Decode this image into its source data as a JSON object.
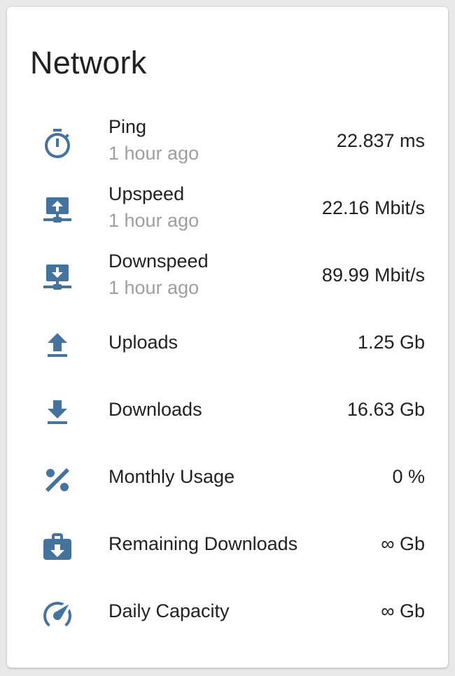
{
  "card": {
    "title": "Network"
  },
  "accent_color": "#44739e",
  "rows": [
    {
      "icon": "timer-icon",
      "name": "Ping",
      "sub": "1 hour ago",
      "value": "22.837 ms"
    },
    {
      "icon": "upload-network-icon",
      "name": "Upspeed",
      "sub": "1 hour ago",
      "value": "22.16 Mbit/s"
    },
    {
      "icon": "download-network-icon",
      "name": "Downspeed",
      "sub": "1 hour ago",
      "value": "89.99 Mbit/s"
    },
    {
      "icon": "upload-icon",
      "name": "Uploads",
      "value": "1.25 Gb"
    },
    {
      "icon": "download-icon",
      "name": "Downloads",
      "value": "16.63 Gb"
    },
    {
      "icon": "percent-icon",
      "name": "Monthly Usage",
      "value": "0 %"
    },
    {
      "icon": "briefcase-download-icon",
      "name": "Remaining Downloads",
      "value": "∞ Gb"
    },
    {
      "icon": "speedometer-icon",
      "name": "Daily Capacity",
      "value": "∞ Gb"
    }
  ]
}
